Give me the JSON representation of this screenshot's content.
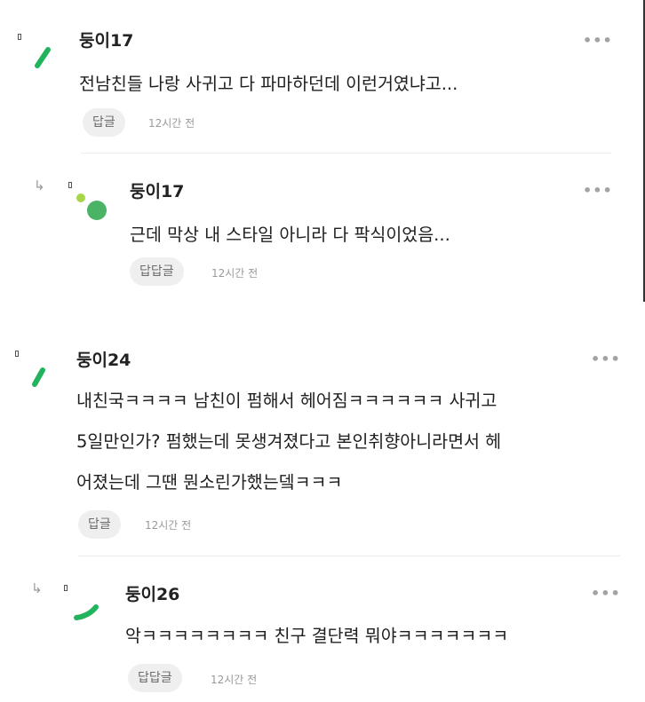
{
  "thread1": {
    "comment": {
      "author": "둥이17",
      "text": "전남친들 나랑 사귀고 다 파마하던데 이런거였냐고...",
      "reply_label": "답글",
      "time": "12시간 전",
      "more": "•••"
    },
    "reply": {
      "arrow": "↳",
      "author": "둥이17",
      "text": "근데 막상 내 스타일 아니라 다 팍식이었음...",
      "reply_label": "답답글",
      "time": "12시간 전",
      "more": "•••"
    }
  },
  "thread2": {
    "comment": {
      "author": "둥이24",
      "text_lines": [
        "내친국ㅋㅋㅋㅋ 남친이 펌해서 헤어짐ㅋㅋㅋㅋㅋㅋ 사귀고",
        "5일만인가? 펌했는데 못생겨졌다고 본인취향아니라면서 헤",
        "어졌는데 그땐 뭔소린가했는뎈ㅋㅋㅋ"
      ],
      "reply_label": "답글",
      "time": "12시간 전",
      "more": "•••"
    },
    "reply": {
      "arrow": "↳",
      "author": "둥이26",
      "text": "악ㅋㅋㅋㅋㅋㅋㅋㅋ 친구 결단력 뭐야ㅋㅋㅋㅋㅋㅋㅋ",
      "reply_label": "답답글",
      "time": "12시간 전",
      "more": "•••"
    }
  },
  "colors": {
    "avatar_green": "#22b35e",
    "avatar_light_green": "#a8d64a",
    "avatar_mid_green": "#4bb365"
  }
}
